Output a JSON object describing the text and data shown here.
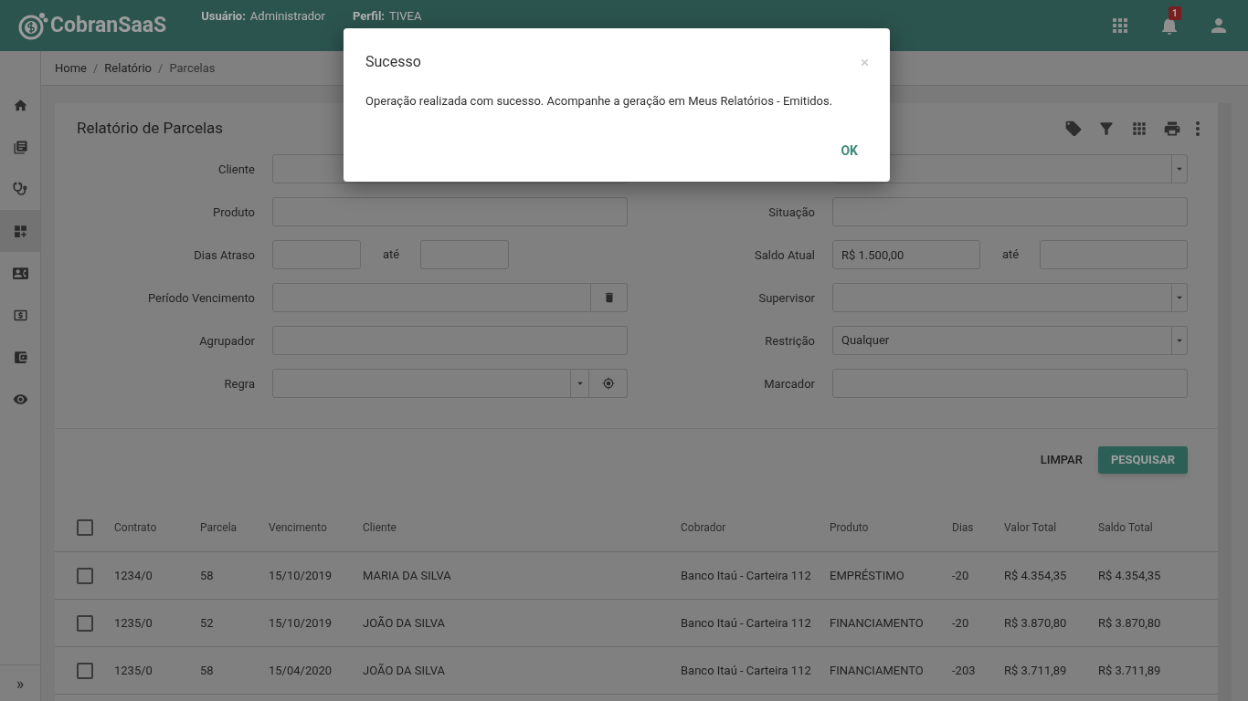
{
  "header": {
    "brand": "CobranSaaS",
    "user_label": "Usuário:",
    "user": "Administrador",
    "profile_label": "Perfil:",
    "profile": "TIVEA",
    "notifications": "1"
  },
  "sidebar": {
    "items": [
      {
        "selected": false
      },
      {
        "selected": false
      },
      {
        "selected": false
      },
      {
        "selected": true
      },
      {
        "selected": false
      },
      {
        "selected": false
      },
      {
        "selected": false
      },
      {
        "selected": false
      }
    ],
    "expand": "»"
  },
  "breadcrumb": [
    {
      "kind": "link",
      "text": "Home"
    },
    {
      "kind": "separator",
      "text": "/"
    },
    {
      "kind": "link",
      "text": "Relatório"
    },
    {
      "kind": "separator",
      "text": "/"
    },
    {
      "kind": "current",
      "text": "Parcelas"
    }
  ],
  "card": {
    "title": "Relatório de Parcelas",
    "form": [
      {
        "left": {
          "label": "Cliente",
          "kind": "text"
        },
        "right": {
          "kind": "select"
        }
      },
      {
        "left": {
          "label": "Produto",
          "kind": "text"
        },
        "right": {
          "label": "Situação",
          "kind": "text"
        }
      },
      {
        "left": {
          "label": "Dias Atraso",
          "kind": "range",
          "between": "até"
        },
        "right": {
          "label": "Saldo Atual",
          "kind": "range",
          "value": "R$ 1.500,00",
          "between": "até"
        }
      },
      {
        "left": {
          "label": "Período Vencimento",
          "kind": "date"
        },
        "right": {
          "label": "Supervisor",
          "kind": "select"
        }
      },
      {
        "left": {
          "label": "Agrupador",
          "kind": "text"
        },
        "right": {
          "label": "Restrição",
          "kind": "select",
          "value": "Qualquer"
        }
      },
      {
        "left": {
          "label": "Regra",
          "kind": "rule"
        },
        "right": {
          "label": "Marcador",
          "kind": "text"
        }
      }
    ],
    "buttons": {
      "clear": "LIMPAR",
      "search": "PESQUISAR"
    },
    "table": {
      "header_checked": false,
      "columns": [
        "Contrato",
        "Parcela",
        "Vencimento",
        "Cliente",
        "Cobrador",
        "Produto",
        "Dias",
        "Valor Total",
        "Saldo Total"
      ],
      "rows": [
        {
          "checked": false,
          "cells": [
            "1234/0",
            "58",
            "15/10/2019",
            "MARIA DA SILVA",
            "Banco Itaú - Carteira 112",
            "EMPRÉSTIMO",
            "-20",
            "R$ 4.354,35",
            "R$ 4.354,35"
          ]
        },
        {
          "checked": false,
          "cells": [
            "1235/0",
            "52",
            "15/10/2019",
            "JOÃO DA SILVA",
            "Banco Itaú - Carteira 112",
            "FINANCIAMENTO",
            "-20",
            "R$ 3.870,80",
            "R$ 3.870,80"
          ]
        },
        {
          "checked": false,
          "cells": [
            "1235/0",
            "58",
            "15/04/2020",
            "JOÃO DA SILVA",
            "Banco Itaú - Carteira 112",
            "FINANCIAMENTO",
            "-203",
            "R$ 3.711,89",
            "R$ 3.711,89"
          ]
        }
      ]
    }
  },
  "dialog": {
    "title": "Sucesso",
    "close": "×",
    "message": "Operação realizada com sucesso. Acompanhe a geração em Meus Relatórios - Emitidos.",
    "ok": "OK"
  }
}
